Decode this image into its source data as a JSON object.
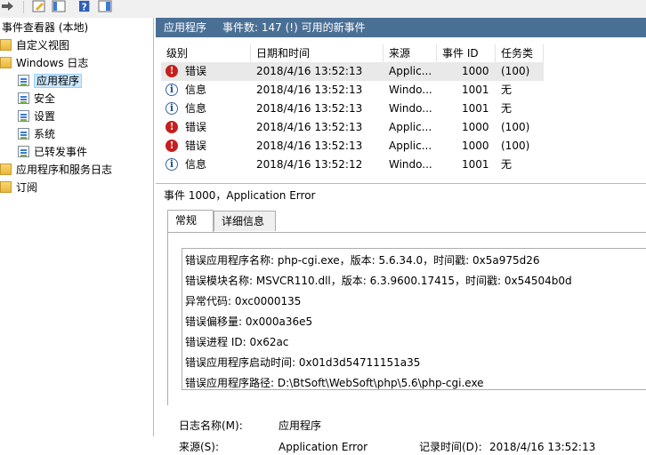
{
  "toolbar": {
    "buttons": [
      "forward-arrow",
      "edit-icon",
      "view-icon",
      "help-icon",
      "properties-icon"
    ]
  },
  "tree": {
    "root": "事件查看器 (本地)",
    "custom_views": "自定义视图",
    "windows_logs": "Windows 日志",
    "application": "应用程序",
    "security": "安全",
    "setup": "设置",
    "system": "系统",
    "forwarded": "已转发事件",
    "apps_services": "应用程序和服务日志",
    "subscriptions": "订阅"
  },
  "header": {
    "title": "应用程序",
    "count": "事件数: 147 (!) 可用的新事件"
  },
  "grid": {
    "columns": [
      "级别",
      "日期和时间",
      "来源",
      "事件 ID",
      "任务类别"
    ],
    "rows": [
      {
        "level": "错误",
        "type": "error",
        "datetime": "2018/4/16 13:52:13",
        "source": "Applic...",
        "id": "1000",
        "category": "(100)"
      },
      {
        "level": "信息",
        "type": "info",
        "datetime": "2018/4/16 13:52:13",
        "source": "Windo...",
        "id": "1001",
        "category": "无"
      },
      {
        "level": "信息",
        "type": "info",
        "datetime": "2018/4/16 13:52:13",
        "source": "Windo...",
        "id": "1001",
        "category": "无"
      },
      {
        "level": "错误",
        "type": "error",
        "datetime": "2018/4/16 13:52:13",
        "source": "Applic...",
        "id": "1000",
        "category": "(100)"
      },
      {
        "level": "错误",
        "type": "error",
        "datetime": "2018/4/16 13:52:13",
        "source": "Applic...",
        "id": "1000",
        "category": "(100)"
      },
      {
        "level": "信息",
        "type": "info",
        "datetime": "2018/4/16 13:52:12",
        "source": "Windo...",
        "id": "1001",
        "category": "无"
      }
    ]
  },
  "detail": {
    "title": "事件 1000，Application Error",
    "tab_general": "常规",
    "tab_details": "详细信息",
    "lines": [
      "错误应用程序名称: php-cgi.exe，版本: 5.6.34.0，时间戳: 0x5a975d26",
      "错误模块名称: MSVCR110.dll，版本: 6.3.9600.17415，时间戳: 0x54504b0d",
      "异常代码: 0xc0000135",
      "错误偏移量: 0x000a36e5",
      "错误进程 ID: 0x62ac",
      "错误应用程序启动时间: 0x01d3d54711151a35",
      "错误应用程序路径: D:\\BtSoft\\WebSoft\\php\\5.6\\php-cgi.exe"
    ],
    "log_name_label": "日志名称(M):",
    "log_name_value": "应用程序",
    "source_label": "来源(S):",
    "source_value": "Application Error",
    "logged_label": "记录时间(D):",
    "logged_value": "2018/4/16 13:52:13"
  },
  "colors": {
    "title_bar": "#4a6f95",
    "selection": "#cce8ff",
    "error": "#c4201f",
    "info": "#1f4f9a"
  }
}
